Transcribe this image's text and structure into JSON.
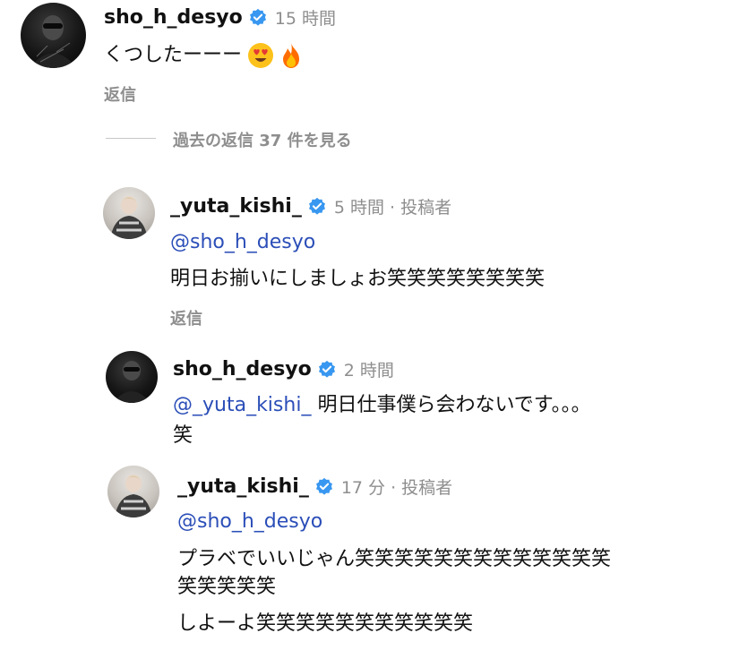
{
  "comment1": {
    "username": "sho_h_desyo",
    "time": "15 時間",
    "text": "くつしたーーー",
    "emojis": [
      "heart-eyes-emoji",
      "fire-emoji"
    ],
    "reply_label": "返信"
  },
  "view_replies_label": "過去の返信 37 件を見る",
  "replies": [
    {
      "username": "_yuta_kishi_",
      "time": "5 時間 · 投稿者",
      "mention": "@sho_h_desyo",
      "lines": [
        "明日お揃いにしましょお笑笑笑笑笑笑笑笑"
      ],
      "reply_label": "返信"
    },
    {
      "username": "sho_h_desyo",
      "time": "2 時間",
      "mention": "@_yuta_kishi_",
      "lines": [
        " 明日仕事僕ら会わないです。。。",
        "笑"
      ]
    },
    {
      "username": "_yuta_kishi_",
      "time": "17 分 · 投稿者",
      "mention": "@sho_h_desyo",
      "lines": [
        "プラベでいいじゃん笑笑笑笑笑笑笑笑笑笑笑笑笑",
        "笑笑笑笑笑",
        "しよーよ笑笑笑笑笑笑笑笑笑笑笑"
      ]
    }
  ],
  "colors": {
    "verified": "#3897f0",
    "mention": "#2b4eb8",
    "meta": "#8e8e8e"
  }
}
